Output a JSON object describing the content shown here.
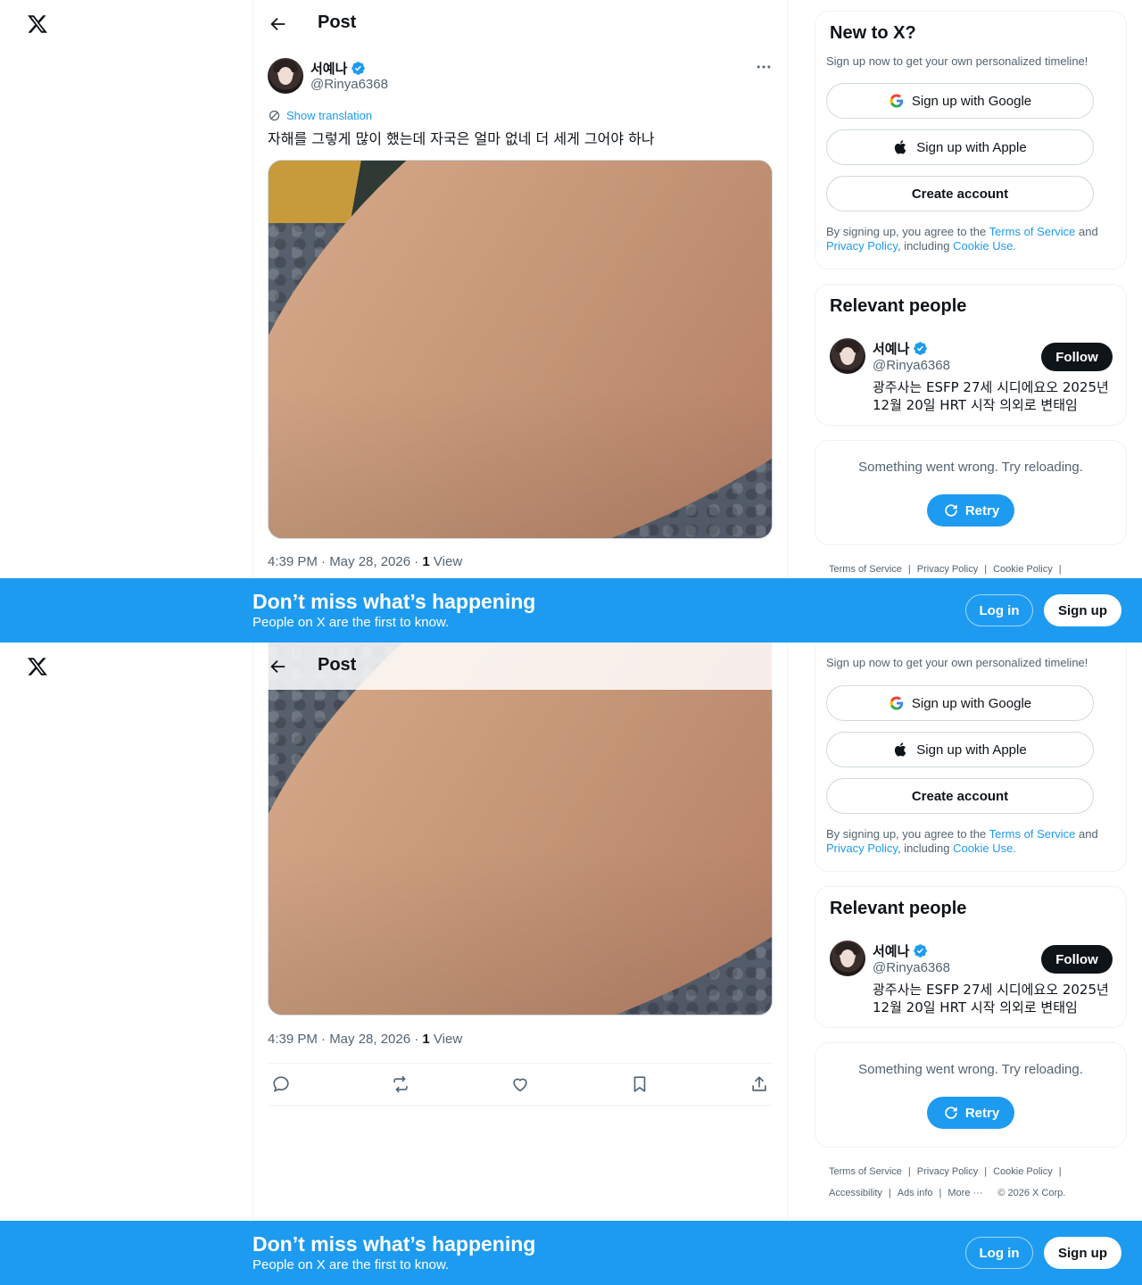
{
  "header": {
    "title": "Post"
  },
  "tweet": {
    "author_name": "서예나",
    "author_handle": "@Rinya6368",
    "show_translation": "Show translation",
    "text": "자해를 그렇게 많이 했는데 자국은 얼마 없네 더 세게 그어야 하나",
    "timestamp": "4:39 PM · May 28, 2026 · ",
    "views_count": "1",
    "views_label": " View"
  },
  "signup_card": {
    "title": "New to X?",
    "subtitle": "Sign up now to get your own personalized timeline!",
    "google_label": "Sign up with Google",
    "apple_label": "Sign up with Apple",
    "create_label": "Create account",
    "legal_prefix": "By signing up, you agree to the ",
    "terms_link": "Terms of Service",
    "legal_and": " and ",
    "privacy_link": "Privacy Policy",
    "legal_including": ", including ",
    "cookie_link": "Cookie Use."
  },
  "relevant_people": {
    "title": "Relevant people",
    "name": "서예나",
    "handle": "@Rinya6368",
    "follow_label": "Follow",
    "bio": "광주사는 ESFP 27세 시디에요오 2025년 12월 20일 HRT 시작 의외로 변태임"
  },
  "error_card": {
    "message": "Something went wrong. Try reloading.",
    "retry_label": "Retry"
  },
  "footer": {
    "terms": "Terms of Service",
    "privacy": "Privacy Policy",
    "cookie": "Cookie Policy",
    "accessibility": "Accessibility",
    "ads_info": "Ads info",
    "more": "More ···",
    "copyright": "© 2026 X Corp.",
    "sep": "|"
  },
  "banner": {
    "title": "Don’t miss what’s happening",
    "subtitle": "People on X are the first to know.",
    "login_label": "Log in",
    "signup_label": "Sign up"
  },
  "icons": {
    "logo": "x-logo-icon",
    "back": "arrow-left-icon",
    "more": "more-horizontal-icon",
    "verified": "verified-badge-icon",
    "translate": "translate-icon",
    "reply": "reply-icon",
    "repost": "repost-icon",
    "like": "heart-icon",
    "bookmark": "bookmark-icon",
    "share": "share-icon",
    "google": "google-icon",
    "apple": "apple-icon",
    "retry": "refresh-icon"
  },
  "colors": {
    "accent": "#1d9bf0",
    "text": "#0f1419",
    "muted": "#536471",
    "border": "#eff3f4"
  }
}
